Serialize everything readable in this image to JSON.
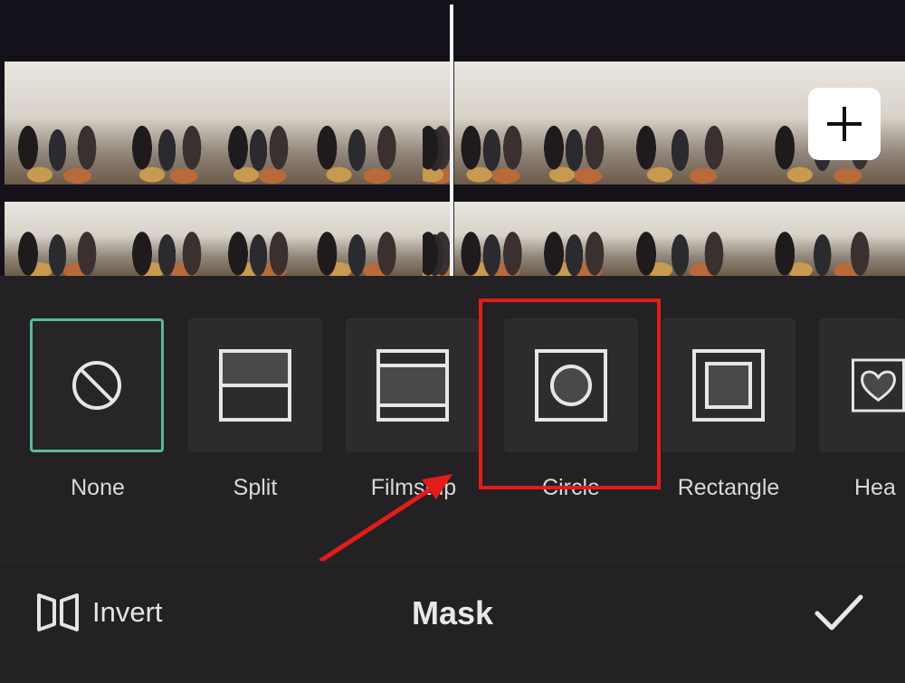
{
  "masks": {
    "items": [
      {
        "label": "None",
        "icon": "none-mask-icon",
        "selected": true
      },
      {
        "label": "Split",
        "icon": "split-mask-icon",
        "selected": false
      },
      {
        "label": "Filmstrip",
        "icon": "filmstrip-mask-icon",
        "selected": false
      },
      {
        "label": "Circle",
        "icon": "circle-mask-icon",
        "selected": false
      },
      {
        "label": "Rectangle",
        "icon": "rectangle-mask-icon",
        "selected": false
      },
      {
        "label": "Hea",
        "icon": "heart-mask-icon",
        "selected": false
      }
    ]
  },
  "toolbar": {
    "invert_label": "Invert",
    "title": "Mask"
  },
  "colors": {
    "selection": "#5bb89c",
    "annotation": "#e31b1b",
    "panel": "#232123"
  }
}
